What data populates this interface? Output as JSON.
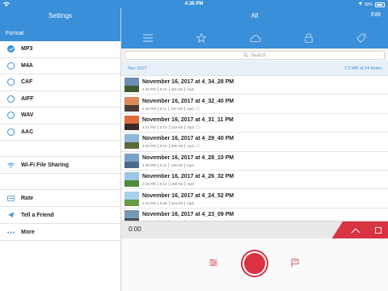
{
  "status": {
    "time": "4:36 PM",
    "battery": "80%"
  },
  "sidebar": {
    "title": "Settings",
    "section": "Format",
    "formats": [
      {
        "label": "MP3",
        "checked": true
      },
      {
        "label": "M4A",
        "checked": false
      },
      {
        "label": "CAF",
        "checked": false
      },
      {
        "label": "AIFF",
        "checked": false
      },
      {
        "label": "WAV",
        "checked": false
      },
      {
        "label": "AAC",
        "checked": false
      }
    ],
    "wifi": "Wi-Fi File Sharing",
    "rate": "Rate",
    "tell": "Tell a Friend",
    "more": "More"
  },
  "main": {
    "title": "All",
    "edit": "Edit",
    "search_placeholder": "Search",
    "month": "Nov 2017",
    "summary": "7.3 MB of 24 Items",
    "rows": [
      {
        "name": "November 16, 2017 at 4_34_28 PM",
        "time": "4:34 PM",
        "dur": "0:12",
        "size": "251 KB",
        "fmt": "mp3",
        "icon": false,
        "sky": "#6a8fb3",
        "land": "#3f5a2e"
      },
      {
        "name": "November 16, 2017 at 4_32_40 PM",
        "time": "4:32 PM",
        "dur": "0:11",
        "size": "237 KB",
        "fmt": "mp3",
        "icon": true,
        "sky": "#d98a5a",
        "land": "#4a3b33"
      },
      {
        "name": "November 16, 2017 at 4_31_11 PM",
        "time": "4:31 PM",
        "dur": "0:10",
        "size": "218 KB",
        "fmt": "mp3",
        "icon": true,
        "sky": "#e06a3c",
        "land": "#3b2a2a"
      },
      {
        "name": "November 16, 2017 at 4_29_40 PM",
        "time": "4:29 PM",
        "dur": "0:15",
        "size": "295 KB",
        "fmt": "mp3",
        "icon": true,
        "sky": "#8fb8d8",
        "land": "#5a6b3a"
      },
      {
        "name": "November 16, 2017 at 4_28_10 PM",
        "time": "4:28 PM",
        "dur": "0:11",
        "size": "245 KB",
        "fmt": "mp3",
        "icon": false,
        "sky": "#7aa2c8",
        "land": "#4b6b8a"
      },
      {
        "name": "November 16, 2017 at 4_26_32 PM",
        "time": "4:26 PM",
        "dur": "0:12",
        "size": "258 KB",
        "fmt": "mp3",
        "icon": false,
        "sky": "#9cc7e6",
        "land": "#4f8a3a"
      },
      {
        "name": "November 16, 2017 at 4_24_52 PM",
        "time": "4:24 PM",
        "dur": "0:09",
        "size": "204 KB",
        "fmt": "mp3",
        "icon": false,
        "sky": "#a8d0ef",
        "land": "#6a9b45"
      },
      {
        "name": "November 16, 2017 at 4_23_09 PM",
        "time": "4:23 PM",
        "dur": "0:11",
        "size": "236 KB",
        "fmt": "mp3",
        "icon": false,
        "sky": "#7b97b5",
        "land": "#4a4f5a"
      }
    ]
  },
  "player": {
    "time": "0:00"
  },
  "colors": {
    "accent": "#3a8fd9",
    "record": "#d93342"
  }
}
